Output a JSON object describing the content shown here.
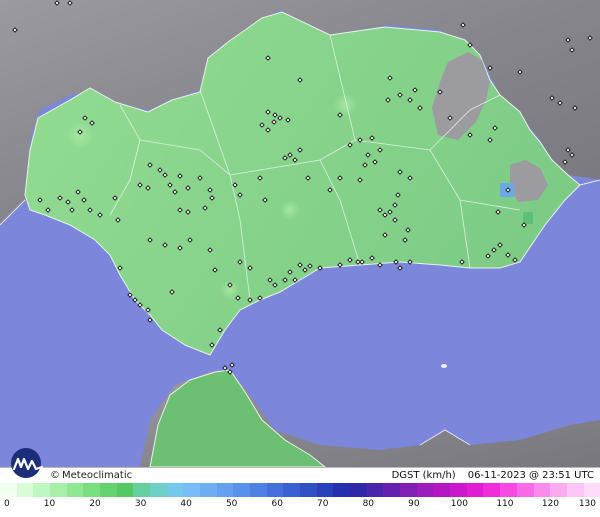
{
  "footer": {
    "brand_symbol": "©",
    "brand": "Meteoclimatic",
    "variable": "DGST (km/h)",
    "timestamp": "06-11-2023 @ 23:51 UTC"
  },
  "legend": {
    "ticks": [
      "0",
      "10",
      "20",
      "30",
      "40",
      "50",
      "60",
      "70",
      "80",
      "90",
      "100",
      "110",
      "120",
      "130"
    ],
    "colors": [
      "#f0fff0",
      "#d8fcd8",
      "#bff7c0",
      "#a8f0aa",
      "#90e894",
      "#78df80",
      "#64d26f",
      "#56c863",
      "#66cfa0",
      "#6fd0c8",
      "#74c8ea",
      "#78bdf7",
      "#70aef4",
      "#649ff0",
      "#5890ec",
      "#4e80e6",
      "#4470dc",
      "#3a60d2",
      "#3050c6",
      "#2a40ba",
      "#2630ae",
      "#3028a8",
      "#4a24aa",
      "#6420ae",
      "#8020b4",
      "#9c1cbc",
      "#b418c4",
      "#cc18cc",
      "#e01cd4",
      "#f02cdc",
      "#f64ae2",
      "#f96ae8",
      "#fb8aed",
      "#fcaaf2",
      "#fdc6f6",
      "#fedcf9"
    ],
    "water_color": "#7c86da",
    "land_color": "#8fd88e",
    "terrain_color": "#8a8a8e"
  },
  "icons": {
    "logo": "meteoclimatic-logo-icon",
    "station": "station-marker-icon"
  }
}
